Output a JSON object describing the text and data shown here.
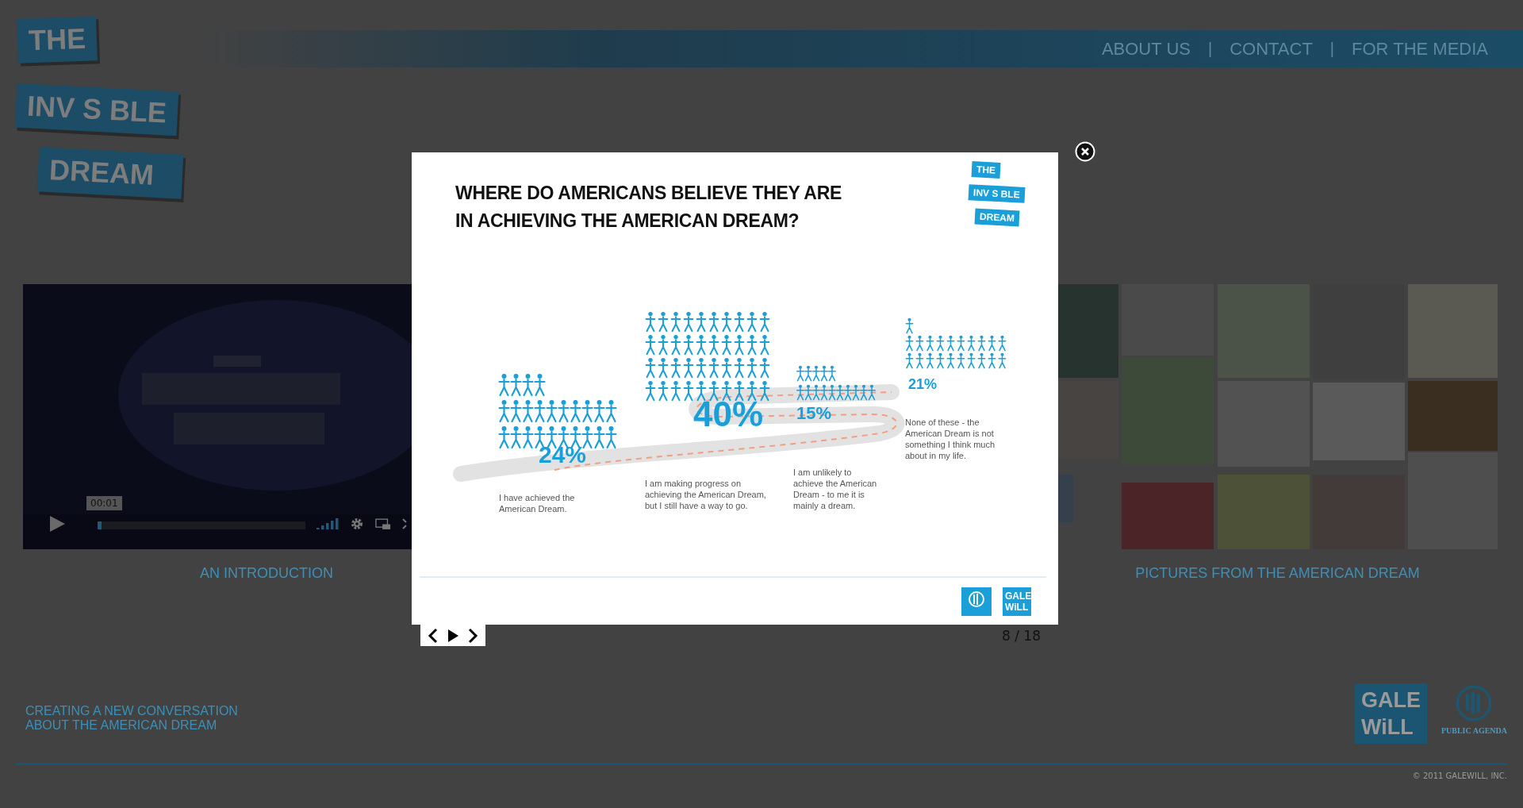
{
  "logo": {
    "lines": [
      "THE",
      "INV S BLE",
      "DREAM"
    ]
  },
  "nav": {
    "items": [
      {
        "kind": "link",
        "label": "ABOUT US"
      },
      {
        "kind": "separator",
        "label": "|"
      },
      {
        "kind": "link",
        "label": "CONTACT"
      },
      {
        "kind": "separator",
        "label": "|"
      },
      {
        "kind": "link",
        "label": "FOR THE MEDIA"
      }
    ]
  },
  "video": {
    "kind": "picture",
    "time": "00:01",
    "progress": {
      "level": 0.02
    },
    "caption": "AN INTRODUCTION"
  },
  "gallery": {
    "kind": "picture",
    "caption": "PICTURES FROM THE AMERICAN DREAM"
  },
  "tagline": [
    "CREATING A NEW CONVERSATION",
    "ABOUT THE AMERICAN DREAM"
  ],
  "partners": {
    "galewill": [
      "GALE",
      "WiLL"
    ],
    "public_agenda": "PUBLIC AGENDA"
  },
  "copyright": "© 2011 GALEWILL, INC.",
  "lightbox": {
    "title_lines": [
      "WHERE DO AMERICANS BELIEVE THEY ARE",
      "IN ACHIEVING THE AMERICAN DREAM?"
    ],
    "logo": [
      "THE",
      "INV S BLE",
      "DREAM"
    ],
    "groups": [
      {
        "percent": "24%",
        "lines": [
          "I have achieved the",
          "American Dream."
        ]
      },
      {
        "percent": "40%",
        "lines": [
          "I am making progress on",
          "achieving the American Dream,",
          "but I still have a way to go."
        ]
      },
      {
        "percent": "15%",
        "lines": [
          "I am unlikely to",
          "achieve the American",
          "Dream - to me it is",
          "mainly a dream."
        ]
      },
      {
        "percent": "21%",
        "lines": [
          "None of these - the",
          "American Dream is not",
          "something I think much",
          "about in my life."
        ]
      }
    ],
    "footer_logo": [
      "GALE",
      "WiLL"
    ],
    "counter": "8 / 18"
  }
}
